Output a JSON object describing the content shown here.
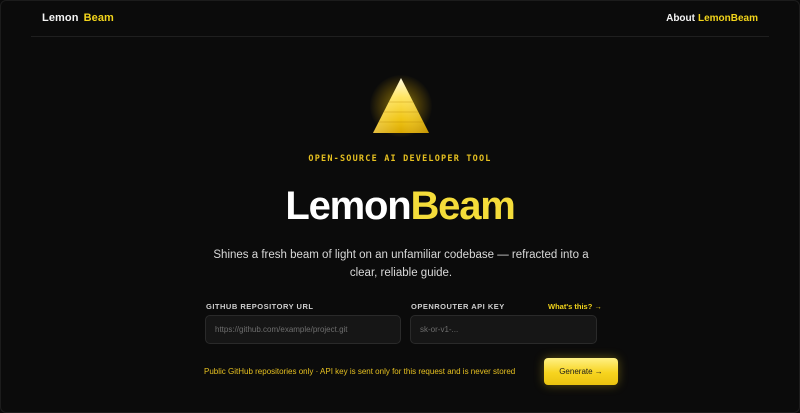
{
  "header": {
    "brand_word1": "Lemon",
    "brand_word2": "Beam",
    "about_prefix": "About",
    "about_name": "LemonBeam"
  },
  "logo": {
    "icon": "glowing-prism-icon"
  },
  "hero": {
    "eyebrow": "OPEN-SOURCE AI DEVELOPER TOOL",
    "title_part1": "Lemon",
    "title_part2": "Beam",
    "subtitle": "Shines a fresh beam of light on an unfamiliar codebase — refracted into a clear, reliable guide."
  },
  "form": {
    "repo_label": "GITHUB REPOSITORY URL",
    "repo_placeholder": "https://github.com/example/project.git",
    "repo_value": "",
    "key_label": "OPENROUTER API KEY",
    "key_help": "What's this? →",
    "key_placeholder": "sk-or-v1-...",
    "key_value": "",
    "note": "Public GitHub repositories only · API key is sent only for this request and is never stored",
    "generate_label": "Generate →"
  },
  "colors": {
    "accent": "#f2d41b",
    "background": "#0a0a0a",
    "input_bg": "#161616"
  }
}
